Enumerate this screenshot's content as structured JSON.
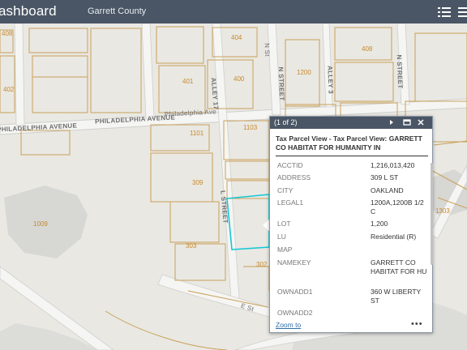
{
  "header": {
    "app_title": "ashboard",
    "county": "Garrett County",
    "icons": [
      "list-icon",
      "layers-icon"
    ]
  },
  "map": {
    "parcel_labels": [
      "408",
      "402",
      "404",
      "401",
      "400",
      "1200",
      "408",
      "1101",
      "1103",
      "309",
      "303",
      "302",
      "1009",
      "1303"
    ],
    "street_labels": [
      "PHILADELPHIA AVENUE",
      "PHILADELPHIA AVENUE",
      "Philadelphia Ave",
      "ALLEY 17",
      "N STREET",
      "ALLEY 3",
      "N STREET",
      "L STREET",
      "E St",
      "N St"
    ],
    "colors": {
      "parcel": "#c9a158",
      "selected": "#17c8d6",
      "road": "#f3f3f1",
      "road_edge": "#c9c9c6",
      "header": "#4a5665"
    }
  },
  "popup": {
    "count": "(1 of 2)",
    "title": "Tax Parcel View - Tax Parcel View: GARRETT CO HABITAT FOR HUMANITY IN",
    "fields": [
      {
        "key": "ACCTID",
        "value": "1,216,013,420"
      },
      {
        "key": "ADDRESS",
        "value": "309 L ST"
      },
      {
        "key": "CITY",
        "value": "OAKLAND"
      },
      {
        "key": "LEGAL1",
        "value": "1200A,1200B 1/2 C"
      },
      {
        "key": "LOT",
        "value": "1,200"
      },
      {
        "key": "LU",
        "value": "Residential (R)"
      },
      {
        "key": "MAP",
        "value": ""
      },
      {
        "key": "NAMEKEY",
        "value": "GARRETT CO HABITAT FOR HU"
      },
      {
        "key": "OWNADD1",
        "value": "360 W LIBERTY ST"
      },
      {
        "key": "OWNADD2",
        "value": ""
      }
    ],
    "zoom_label": "Zoom to",
    "more_label": "•••"
  }
}
